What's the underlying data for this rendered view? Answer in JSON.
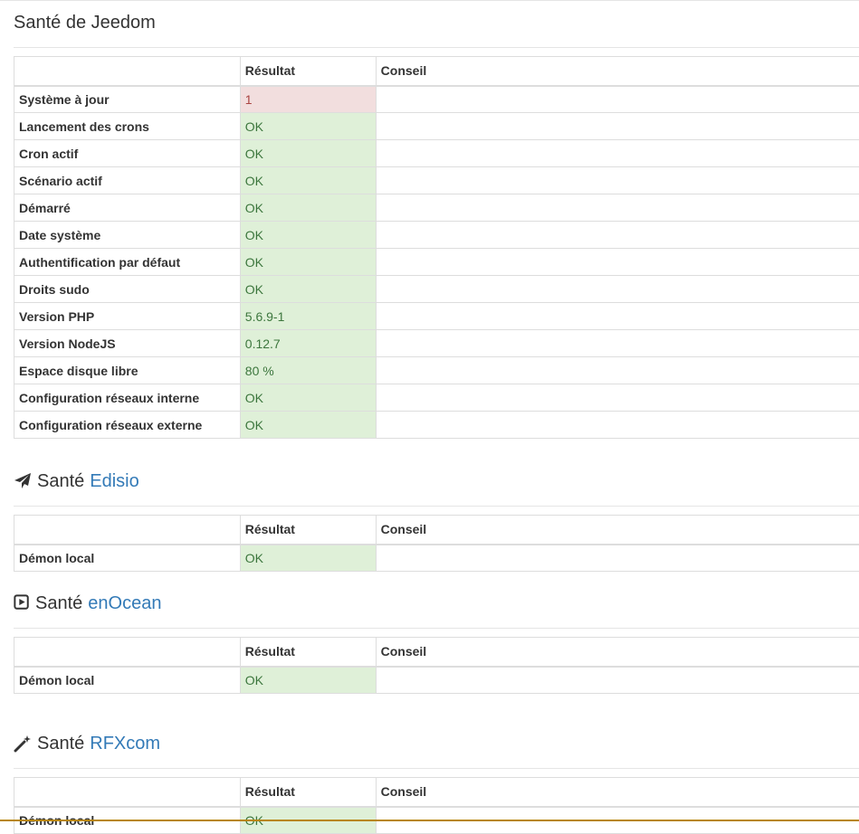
{
  "jeedom": {
    "title": "Santé de Jeedom",
    "headers": [
      "",
      "Résultat",
      "Conseil"
    ],
    "rows": [
      {
        "label": "Système à jour",
        "result": "1",
        "status": "bad",
        "advice": ""
      },
      {
        "label": "Lancement des crons",
        "result": "OK",
        "status": "ok",
        "advice": ""
      },
      {
        "label": "Cron actif",
        "result": "OK",
        "status": "ok",
        "advice": ""
      },
      {
        "label": "Scénario actif",
        "result": "OK",
        "status": "ok",
        "advice": ""
      },
      {
        "label": "Démarré",
        "result": "OK",
        "status": "ok",
        "advice": ""
      },
      {
        "label": "Date système",
        "result": "OK",
        "status": "ok",
        "advice": ""
      },
      {
        "label": "Authentification par défaut",
        "result": "OK",
        "status": "ok",
        "advice": ""
      },
      {
        "label": "Droits sudo",
        "result": "OK",
        "status": "ok",
        "advice": ""
      },
      {
        "label": "Version PHP",
        "result": "5.6.9-1",
        "status": "ok",
        "advice": ""
      },
      {
        "label": "Version NodeJS",
        "result": "0.12.7",
        "status": "ok",
        "advice": ""
      },
      {
        "label": "Espace disque libre",
        "result": "80 %",
        "status": "ok",
        "advice": ""
      },
      {
        "label": "Configuration réseaux interne",
        "result": "OK",
        "status": "ok",
        "advice": ""
      },
      {
        "label": "Configuration réseaux externe",
        "result": "OK",
        "status": "ok",
        "advice": ""
      }
    ]
  },
  "plugins": [
    {
      "prefix": "Santé",
      "name": "Edisio",
      "icon": "paper-plane-icon",
      "headers": [
        "",
        "Résultat",
        "Conseil"
      ],
      "rows": [
        {
          "label": "Démon local",
          "result": "OK",
          "status": "ok",
          "advice": ""
        }
      ]
    },
    {
      "prefix": "Santé",
      "name": "enOcean",
      "icon": "play-square-icon",
      "headers": [
        "",
        "Résultat",
        "Conseil"
      ],
      "rows": [
        {
          "label": "Démon local",
          "result": "OK",
          "status": "ok",
          "advice": ""
        }
      ]
    },
    {
      "prefix": "Santé",
      "name": "RFXcom",
      "icon": "magic-wand-icon",
      "headers": [
        "",
        "Résultat",
        "Conseil"
      ],
      "rows": [
        {
          "label": "Démon local",
          "result": "OK",
          "status": "ok",
          "advice": ""
        }
      ]
    }
  ],
  "colors": {
    "ok_bg": "#dff0d8",
    "ok_text": "#3c763d",
    "bad_bg": "#f2dede",
    "bad_text": "#a94442",
    "link": "#337ab7"
  }
}
